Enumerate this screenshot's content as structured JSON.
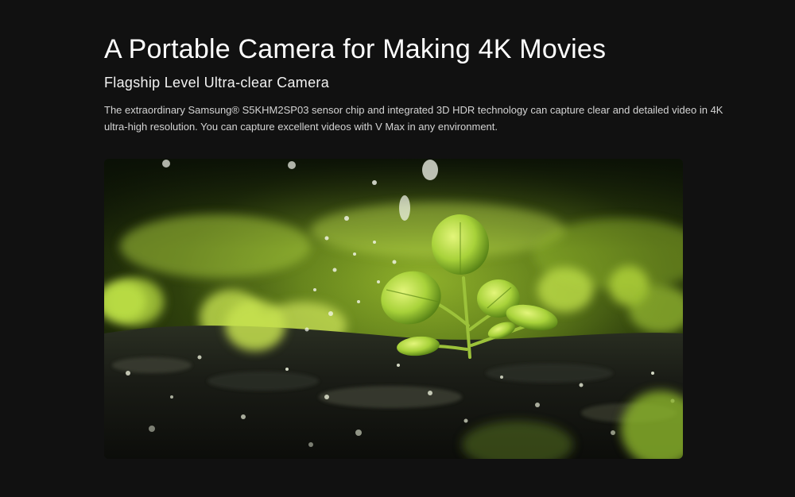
{
  "section": {
    "headline": "A Portable Camera for Making 4K Movies",
    "subheadline": "Flagship Level Ultra-clear Camera",
    "description": "The extraordinary  Samsung® S5KHM2SP03 sensor chip and integrated 3D HDR technology can capture clear and detailed video in 4K ultra-high resolution. You can capture excellent videos with V Max in any environment."
  },
  "colors": {
    "background": "#111111",
    "text_primary": "#ffffff",
    "text_secondary": "#d4d4d4",
    "leaf_green": "#a8d23a"
  },
  "media": {
    "hero_image_icon": "seedling-in-water-droplets-photo"
  }
}
